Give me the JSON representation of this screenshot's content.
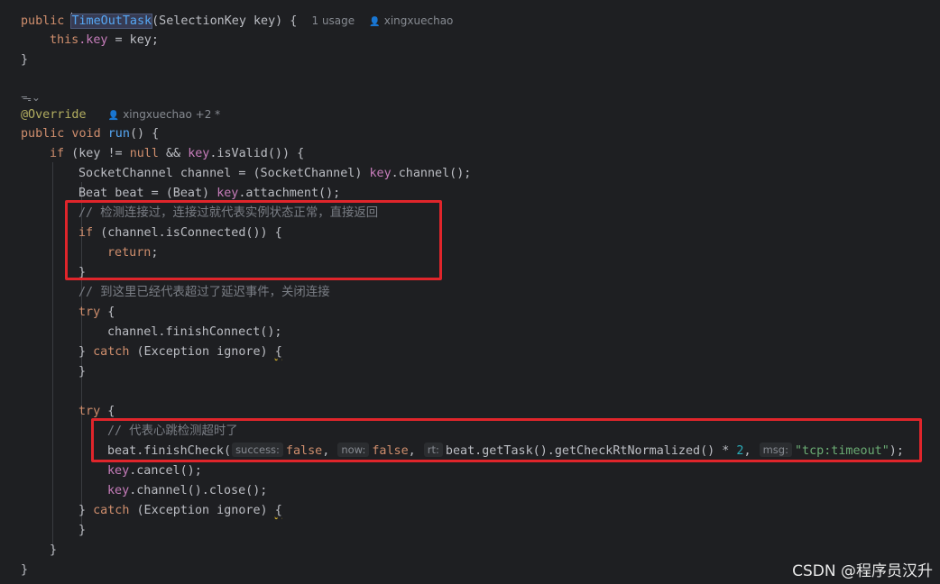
{
  "constructor_meta": {
    "usage": "1 usage",
    "author": "xingxuechao"
  },
  "run_meta": {
    "author": "xingxuechao +2 *"
  },
  "code": {
    "l1_public": "public ",
    "l1_name": "TimeOutTask",
    "l1_rest": "(SelectionKey key) {",
    "l2_this": "this",
    "l2_field": ".key",
    "l2_rest": " = key;",
    "l3": "}",
    "l4_annotation": "@Override",
    "l5_kw": "public void ",
    "l5_fn": "run",
    "l5_rest": "() {",
    "l6_if": "if",
    "l6_a": " (key != ",
    "l6_null": "null",
    "l6_b": " && ",
    "l6_key": "key",
    "l6_c": ".isValid()) {",
    "l7_a": "SocketChannel channel = (SocketChannel) ",
    "l7_key": "key",
    "l7_b": ".channel();",
    "l8_a": "Beat beat = (Beat) ",
    "l8_key": "key",
    "l8_b": ".attachment();",
    "l9_comment": "// 检测连接过，连接过就代表实例状态正常，直接返回",
    "l10_if": "if",
    "l10_rest": " (channel.isConnected()) {",
    "l11_return": "return",
    "l11_rest": ";",
    "l12": "}",
    "l13_comment": "// 到这里已经代表超过了延迟事件，关闭连接",
    "l14_try": "try",
    "l14_rest": " {",
    "l15": "channel.finishConnect();",
    "l16_a": "} ",
    "l16_catch": "catch",
    "l16_b": " (Exception ignore) ",
    "l16_brace": "{",
    "l17": "}",
    "l18_try": "try",
    "l18_rest": " {",
    "l19_comment": "// 代表心跳检测超时了",
    "l20_a": "beat.finishCheck(",
    "l20_hint1": "success:",
    "l20_false1": "false",
    "l20_c1": ", ",
    "l20_hint2": "now:",
    "l20_false2": "false",
    "l20_c2": ", ",
    "l20_hint3": "rt:",
    "l20_b": "beat.getTask().getCheckRtNormalized() * ",
    "l20_num": "2",
    "l20_c3": ", ",
    "l20_hint4": "msg:",
    "l20_str": "\"tcp:timeout\"",
    "l20_end": ");",
    "l21_key": "key",
    "l21_rest": ".cancel();",
    "l22_key": "key",
    "l22_rest": ".channel().close();",
    "l23_a": "} ",
    "l23_catch": "catch",
    "l23_b": " (Exception ignore) ",
    "l23_brace": "{",
    "l24": "}",
    "l25": "}",
    "l26": "}"
  },
  "watermark": "CSDN @程序员汉升",
  "colors": {
    "background": "#1e1f22",
    "keyword": "#cf8e6d",
    "function": "#56a8f5",
    "field": "#c77dbb",
    "annotation": "#b3ae60",
    "comment": "#7a7e85",
    "string": "#6aab73",
    "number": "#2aacb8",
    "highlight_box": "#e0252b"
  }
}
